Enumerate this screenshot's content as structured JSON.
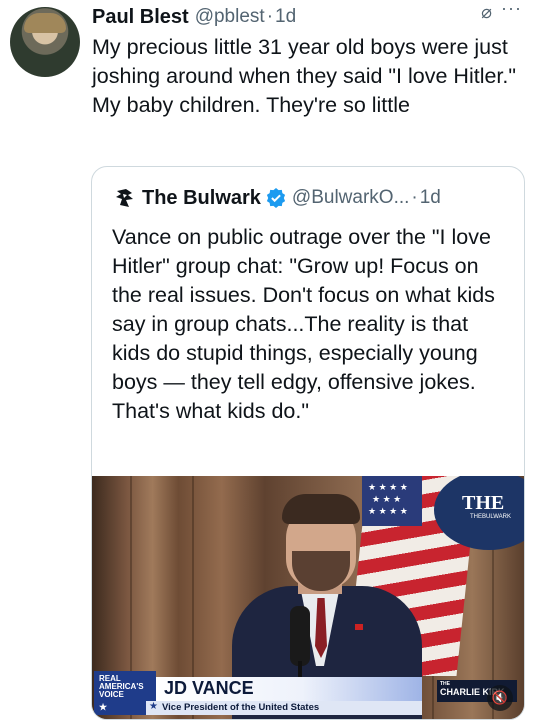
{
  "tweet": {
    "author_name": "Paul Blest",
    "author_handle": "@pblest",
    "separator": "·",
    "time": "1d",
    "text": "My precious little 31 year old boys were just joshing around when they said \"I love Hitler.\" My baby children. They're so little"
  },
  "quoted_tweet": {
    "author_name": "The Bulwark",
    "author_handle": "@BulwarkO...",
    "separator": "·",
    "time": "1d",
    "verified": true,
    "text": "Vance on public outrage over the \"I love Hitler\" group chat: \"Grow up! Focus on the real issues. Don't focus on what kids say in group chats...The reality is that kids do stupid things, especially young boys — they tell edgy, offensive jokes. That's what kids do.\""
  },
  "video": {
    "backdrop_logo": "THE",
    "backdrop_logo_sub": "THEBULWARK",
    "network_label": "REAL AMERICA'S VOICE",
    "name_banner": "JD VANCE",
    "title_banner": "Vice President of the United States",
    "show_pre": "THE",
    "show_name": "CHARLIE KIRK"
  },
  "icons": {
    "grok": "grok-icon",
    "more": "more-icon",
    "verified": "verified-badge-icon",
    "mute": "speaker-muted-icon"
  },
  "colors": {
    "text_primary": "#0f1419",
    "text_secondary": "#536471",
    "border": "#cfd9de",
    "verified_blue": "#1d9bf0"
  }
}
